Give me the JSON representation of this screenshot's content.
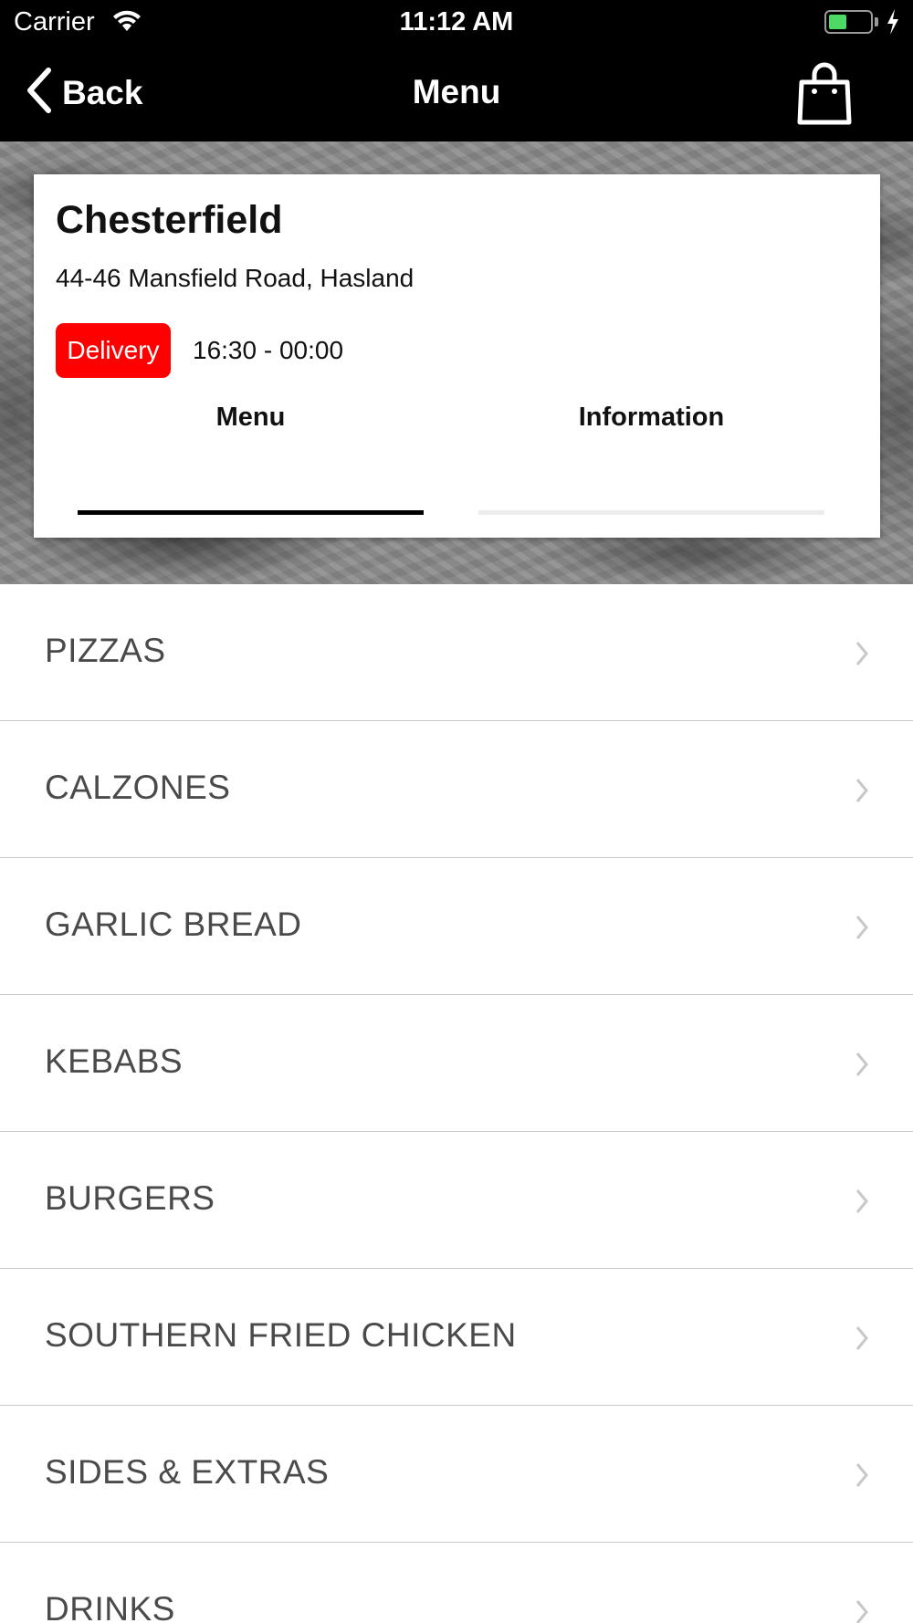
{
  "status_bar": {
    "carrier": "Carrier",
    "time": "11:12 AM",
    "battery_level": 0.45,
    "icons": [
      "wifi-icon",
      "battery-icon",
      "charging-bolt-icon"
    ]
  },
  "nav": {
    "back_label": "Back",
    "title": "Menu",
    "icons": [
      "chevron-left-icon",
      "shopping-bag-icon"
    ]
  },
  "store": {
    "name": "Chesterfield",
    "address": "44-46 Mansfield Road, Hasland",
    "delivery_label": "Delivery",
    "hours": "16:30 - 00:00",
    "tabs": [
      {
        "label": "Menu",
        "active": true
      },
      {
        "label": "Information",
        "active": false
      }
    ]
  },
  "colors": {
    "bar_background": "#000000",
    "delivery_badge": "#ff0000",
    "menu_text": "#4a4a4a",
    "battery_fill": "#4cd964"
  },
  "menu": {
    "items": [
      {
        "label": "PIZZAS"
      },
      {
        "label": "CALZONES"
      },
      {
        "label": "GARLIC BREAD"
      },
      {
        "label": "KEBABS"
      },
      {
        "label": "BURGERS"
      },
      {
        "label": "SOUTHERN FRIED CHICKEN"
      },
      {
        "label": "SIDES & EXTRAS"
      },
      {
        "label": "DRINKS"
      }
    ]
  }
}
